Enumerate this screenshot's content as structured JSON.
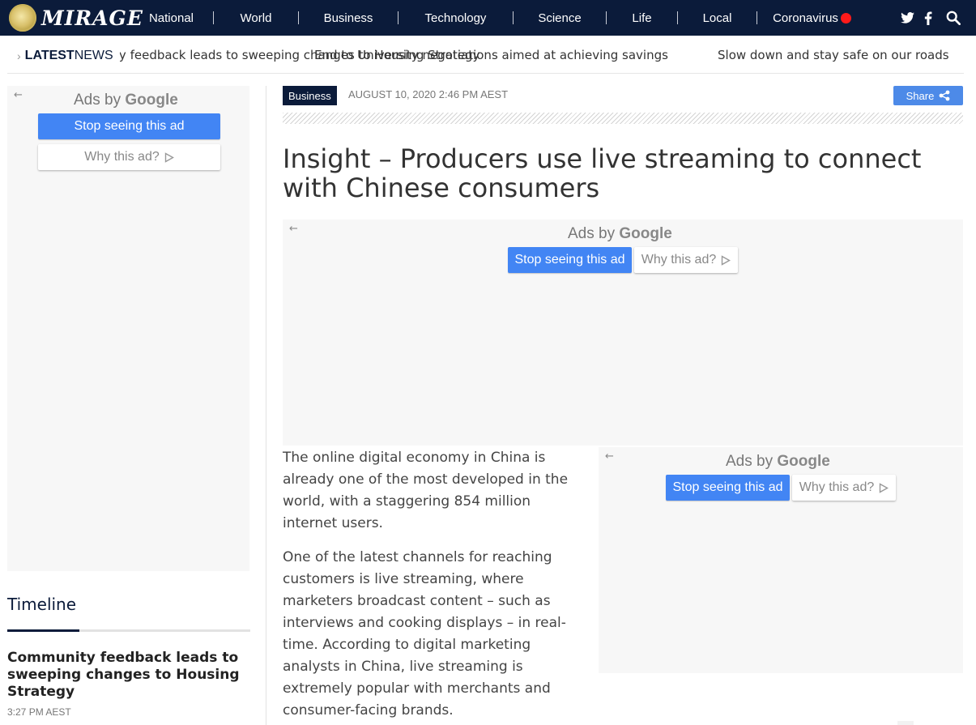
{
  "brand": {
    "name": "MIRAGE"
  },
  "nav": {
    "items": [
      "National",
      "World",
      "Business",
      "Technology",
      "Science",
      "Life",
      "Local",
      "Coronavirus"
    ]
  },
  "social": {
    "twitter": "twitter-icon",
    "facebook": "facebook-icon",
    "search": "search-icon"
  },
  "ticker": {
    "label_bold": "LATEST",
    "label_rest": " NEWS",
    "items": [
      "Community feedback leads to sweeping changes to Housing Strategy",
      "End to University negotiations aimed at achieving savings",
      "Slow down and stay safe on our roads"
    ]
  },
  "ads": {
    "brand_prefix": "Ads by ",
    "brand_name": "Google",
    "stop": "Stop seeing this ad",
    "why": "Why this ad?"
  },
  "timeline": {
    "title": "Timeline",
    "headline": "Community feedback leads to sweeping changes to Housing Strategy",
    "time": "3:27 PM AEST"
  },
  "article": {
    "category": "Business",
    "date": "AUGUST 10, 2020 2:46 PM AEST",
    "share_label": "Share",
    "title": "Insight – Producers use live streaming to connect with Chinese consumers",
    "paragraphs": [
      "The online digital economy in China is already one of the most developed in the world, with a staggering 854 million internet users.",
      "One of the latest channels for reaching customers is live streaming, where marketers broadcast content – such as interviews and cooking displays – in real-time. According to digital marketing analysts in China, live streaming is extremely popular with merchants and consumer-facing brands."
    ]
  },
  "colors": {
    "navy": "#0b1b3a",
    "google_blue": "#4285f4",
    "live_red": "#ff1a1a"
  }
}
